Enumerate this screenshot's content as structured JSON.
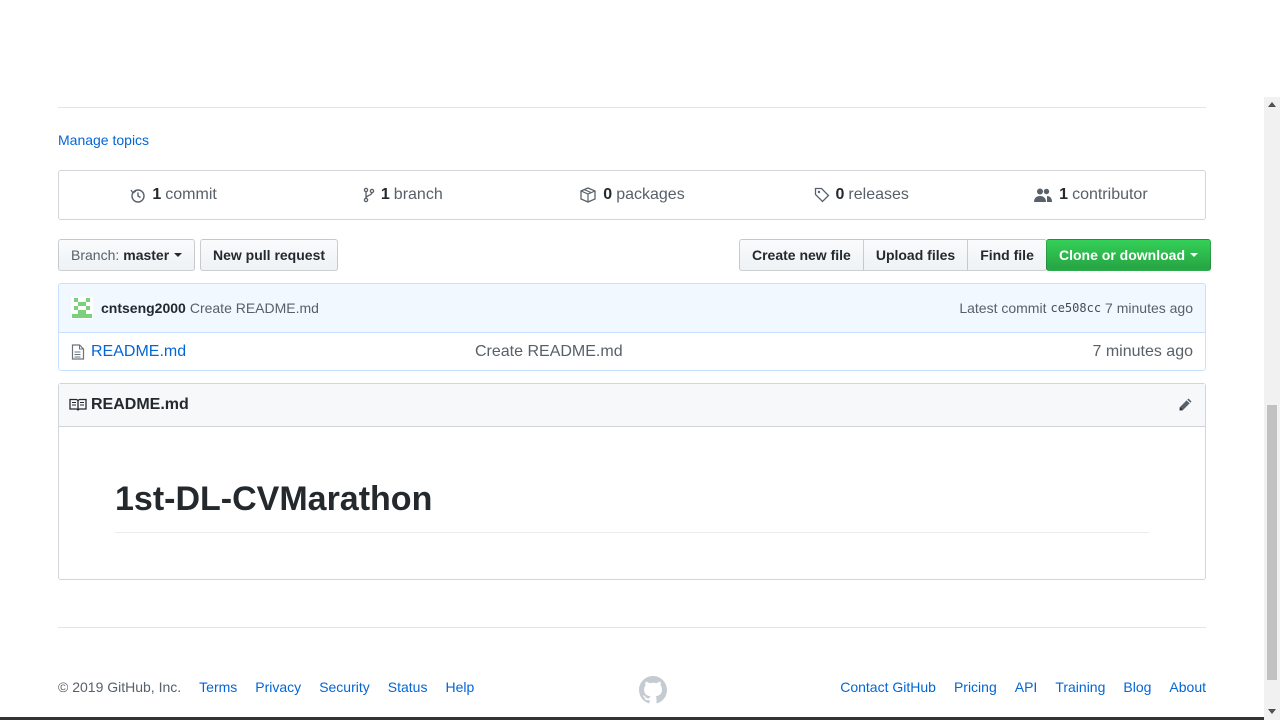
{
  "topics": {
    "manage_label": "Manage topics"
  },
  "numbers": [
    {
      "icon": "history-icon",
      "count": "1",
      "label": "commit"
    },
    {
      "icon": "git-branch-icon",
      "count": "1",
      "label": "branch"
    },
    {
      "icon": "package-icon",
      "count": "0",
      "label": "packages"
    },
    {
      "icon": "tag-icon",
      "count": "0",
      "label": "releases"
    },
    {
      "icon": "people-icon",
      "count": "1",
      "label": "contributor"
    }
  ],
  "toolbar": {
    "branch_prefix": "Branch:",
    "branch_name": "master",
    "new_pr": "New pull request",
    "create_file": "Create new file",
    "upload_files": "Upload files",
    "find_file": "Find file",
    "clone": "Clone or download"
  },
  "commit": {
    "author": "cntseng2000",
    "message": "Create README.md",
    "latest_label": "Latest commit",
    "sha": "ce508cc",
    "age": "7 minutes ago"
  },
  "files": [
    {
      "name": "README.md",
      "message": "Create README.md",
      "age": "7 minutes ago"
    }
  ],
  "readme": {
    "filename": "README.md",
    "heading": "1st-DL-CVMarathon"
  },
  "footer": {
    "copyright": "© 2019 GitHub, Inc.",
    "left_links": [
      "Terms",
      "Privacy",
      "Security",
      "Status",
      "Help"
    ],
    "right_links": [
      "Contact GitHub",
      "Pricing",
      "API",
      "Training",
      "Blog",
      "About"
    ]
  },
  "colors": {
    "link": "#0366d6",
    "green_button": "#28a745",
    "commit_bg": "#f1f8ff"
  }
}
